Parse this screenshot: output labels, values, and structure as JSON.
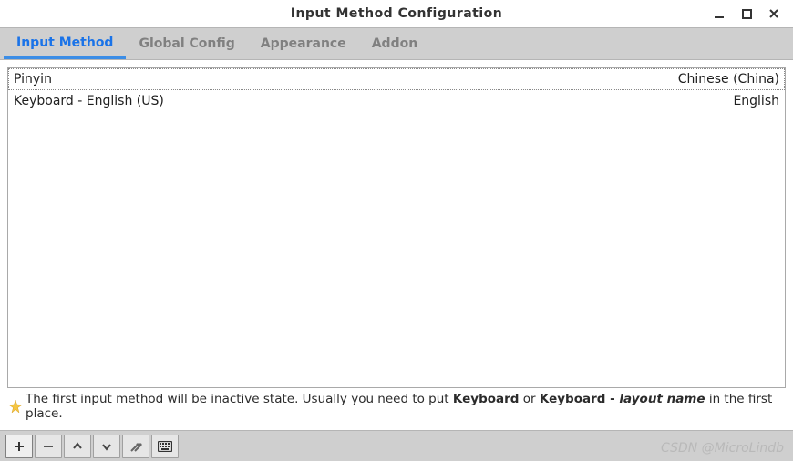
{
  "window": {
    "title": "Input Method Configuration"
  },
  "tabs": [
    {
      "label": "Input Method",
      "active": true
    },
    {
      "label": "Global Config",
      "active": false
    },
    {
      "label": "Appearance",
      "active": false
    },
    {
      "label": "Addon",
      "active": false
    }
  ],
  "input_methods": [
    {
      "name": "Pinyin",
      "language": "Chinese (China)",
      "selected": true
    },
    {
      "name": "Keyboard - English (US)",
      "language": "English",
      "selected": false
    }
  ],
  "hint": {
    "pre": "The first input method will be inactive state. Usually you need to put ",
    "bold1": "Keyboard",
    "mid": " or ",
    "bold2": "Keyboard - ",
    "italic": "layout name",
    "post": " in the first place."
  },
  "toolbar": {
    "add": "+",
    "remove": "−",
    "up": "˄",
    "down": "˅",
    "config": "✦",
    "keyboard": "⌨"
  },
  "watermark": "CSDN @MicroLindb"
}
